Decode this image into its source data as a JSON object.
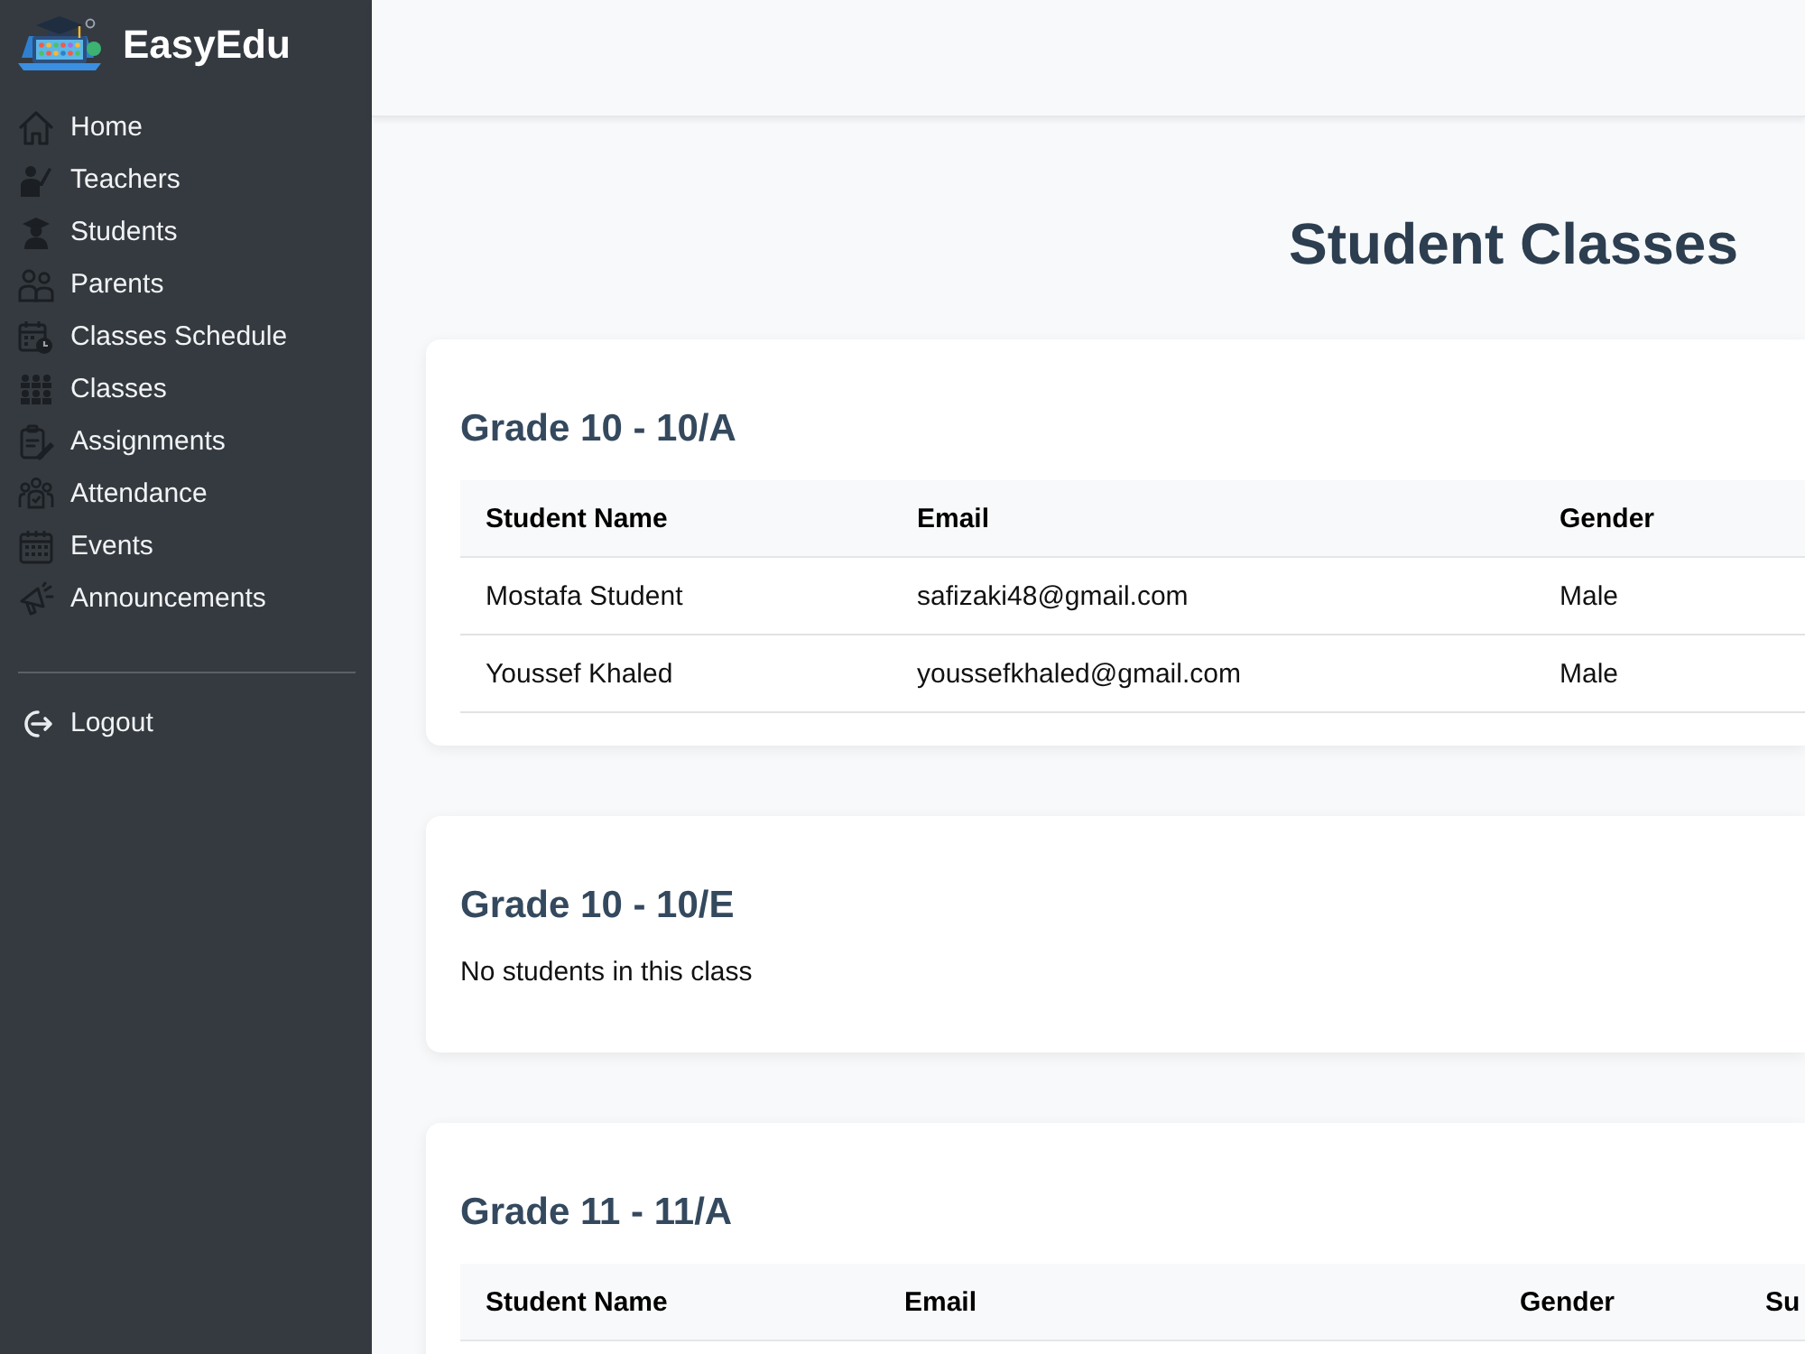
{
  "app": {
    "name": "EasyEdu"
  },
  "sidebar": {
    "items": [
      {
        "label": "Home"
      },
      {
        "label": "Teachers"
      },
      {
        "label": "Students"
      },
      {
        "label": "Parents"
      },
      {
        "label": "Classes Schedule"
      },
      {
        "label": "Classes"
      },
      {
        "label": "Assignments"
      },
      {
        "label": "Attendance"
      },
      {
        "label": "Events"
      },
      {
        "label": "Announcements"
      }
    ],
    "logout": {
      "label": "Logout"
    }
  },
  "page": {
    "title": "Student Classes"
  },
  "classes": [
    {
      "title": "Grade 10 - 10/A",
      "columns": [
        "Student Name",
        "Email",
        "Gender"
      ],
      "rows": [
        [
          "Mostafa Student",
          "safizaki48@gmail.com",
          "Male"
        ],
        [
          "Youssef Khaled",
          "youssefkhaled@gmail.com",
          "Male"
        ]
      ]
    },
    {
      "title": "Grade 10 - 10/E",
      "empty_message": "No students in this class"
    },
    {
      "title": "Grade 11 - 11/A",
      "columns": [
        "Student Name",
        "Email",
        "Gender",
        "Su"
      ]
    }
  ]
}
